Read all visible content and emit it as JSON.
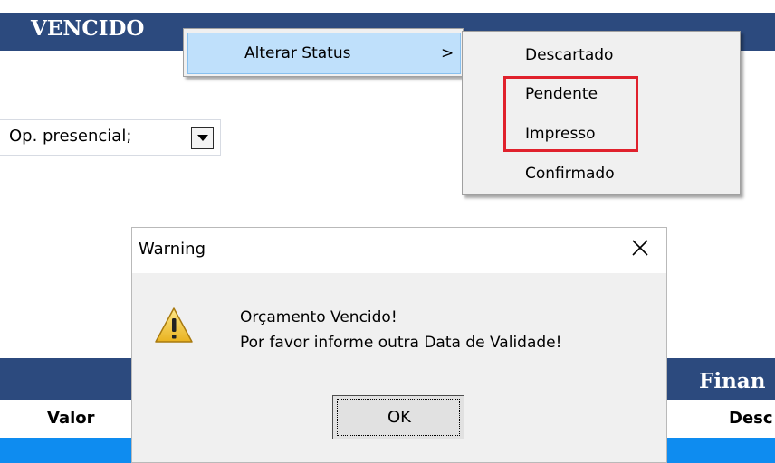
{
  "header": {
    "title": "VENCIDO"
  },
  "combo": {
    "value": "Op. presencial;"
  },
  "section": {
    "right_title": "Finan",
    "col_valor": "Valor",
    "col_desc": "Desc"
  },
  "context_menu": {
    "item_label": "Alterar Status",
    "submenu_arrow": ">",
    "submenu_items": [
      "Descartado",
      "Pendente",
      "Impresso",
      "Confirmado"
    ]
  },
  "dialog": {
    "title": "Warning",
    "message_line1": "Orçamento Vencido!",
    "message_line2": "Por favor informe outra Data de Validade!",
    "ok_label": "OK"
  },
  "icons": {
    "warning": "warning-icon",
    "close": "close-icon",
    "dropdown": "dropdown-arrow-icon"
  },
  "colors": {
    "header_bg": "#2c4a7e",
    "menu_highlight": "#bfe0fb",
    "annotation_red": "#e0212c",
    "grid_selection": "#0e8cf0"
  }
}
